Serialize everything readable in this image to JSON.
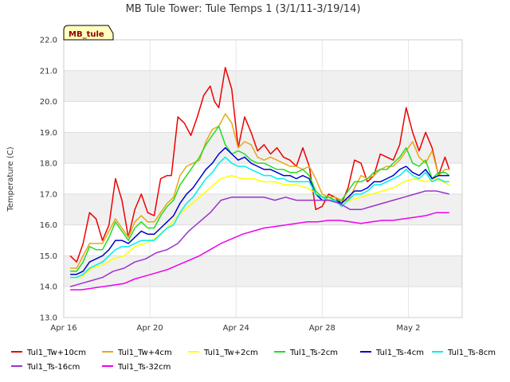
{
  "chart_data": {
    "type": "line",
    "title": "MB Tule Tower: Tule Temps 1 (3/1/11-3/19/14)",
    "badge": "MB_tule",
    "ylabel": "Temperature (C)",
    "xlabel": "",
    "x_ticks": [
      {
        "day": 0,
        "label": "Apr 16"
      },
      {
        "day": 4,
        "label": "Apr 20"
      },
      {
        "day": 8,
        "label": "Apr 24"
      },
      {
        "day": 12,
        "label": "Apr 28"
      },
      {
        "day": 16,
        "label": "May 2"
      }
    ],
    "xlim": [
      0,
      18.5
    ],
    "ylim": [
      13.0,
      22.0
    ],
    "y_ticks": [
      13.0,
      14.0,
      15.0,
      16.0,
      17.0,
      18.0,
      19.0,
      20.0,
      21.0,
      22.0
    ],
    "y_tick_labels": [
      "13.0",
      "14.0",
      "15.0",
      "16.0",
      "17.0",
      "18.0",
      "19.0",
      "20.0",
      "21.0",
      "22.0"
    ],
    "grid": true,
    "band_fill": "#f0f0f0",
    "legend_position": "bottom",
    "series": [
      {
        "name": "Tul1_Tw+10cm",
        "color": "#ee0000",
        "x": [
          0.3,
          0.6,
          0.9,
          1.2,
          1.5,
          1.8,
          2.1,
          2.4,
          2.7,
          3.0,
          3.3,
          3.6,
          3.9,
          4.2,
          4.5,
          4.8,
          5.0,
          5.3,
          5.6,
          5.9,
          6.2,
          6.5,
          6.8,
          7.0,
          7.2,
          7.5,
          7.8,
          8.1,
          8.4,
          8.7,
          9.0,
          9.3,
          9.6,
          9.9,
          10.2,
          10.5,
          10.8,
          11.1,
          11.4,
          11.7,
          12.0,
          12.3,
          12.6,
          12.9,
          13.2,
          13.5,
          13.8,
          14.1,
          14.4,
          14.7,
          15.0,
          15.3,
          15.6,
          15.9,
          16.2,
          16.5,
          16.8,
          17.1,
          17.4,
          17.7,
          17.9
        ],
        "values": [
          15.0,
          14.8,
          15.4,
          16.4,
          16.2,
          15.5,
          16.0,
          17.5,
          16.8,
          15.6,
          16.5,
          17.0,
          16.4,
          16.3,
          17.5,
          17.6,
          17.6,
          19.5,
          19.3,
          18.9,
          19.5,
          20.2,
          20.5,
          20.0,
          19.8,
          21.1,
          20.4,
          18.5,
          19.5,
          19.0,
          18.4,
          18.6,
          18.3,
          18.5,
          18.2,
          18.1,
          17.9,
          18.5,
          17.9,
          16.5,
          16.6,
          17.0,
          16.9,
          16.7,
          17.2,
          18.1,
          18.0,
          17.4,
          17.6,
          18.3,
          18.2,
          18.1,
          18.6,
          19.8,
          19.0,
          18.4,
          19.0,
          18.5,
          17.6,
          18.2,
          17.8
        ]
      },
      {
        "name": "Tul1_Tw+4cm",
        "color": "#e6a817",
        "x": [
          0.3,
          0.6,
          0.9,
          1.2,
          1.5,
          1.8,
          2.1,
          2.4,
          2.7,
          3.0,
          3.3,
          3.6,
          3.9,
          4.2,
          4.5,
          4.8,
          5.1,
          5.4,
          5.7,
          6.0,
          6.3,
          6.6,
          6.9,
          7.2,
          7.5,
          7.8,
          8.1,
          8.4,
          8.7,
          9.0,
          9.3,
          9.6,
          9.9,
          10.2,
          10.5,
          10.8,
          11.1,
          11.4,
          11.7,
          12.0,
          12.3,
          12.6,
          12.9,
          13.2,
          13.5,
          13.8,
          14.1,
          14.4,
          14.7,
          15.0,
          15.3,
          15.6,
          15.9,
          16.2,
          16.5,
          16.8,
          17.1,
          17.4,
          17.7,
          17.9
        ],
        "values": [
          14.6,
          14.6,
          15.0,
          15.4,
          15.4,
          15.4,
          15.8,
          16.2,
          15.9,
          15.6,
          16.1,
          16.3,
          16.1,
          16.1,
          16.4,
          16.7,
          16.9,
          17.6,
          17.9,
          18.0,
          18.1,
          18.7,
          19.1,
          19.2,
          19.6,
          19.3,
          18.5,
          18.7,
          18.6,
          18.2,
          18.1,
          18.2,
          18.1,
          18.0,
          17.9,
          17.9,
          17.8,
          17.9,
          17.5,
          17.0,
          16.9,
          16.9,
          16.8,
          16.8,
          17.2,
          17.6,
          17.5,
          17.6,
          17.8,
          17.9,
          17.9,
          18.1,
          18.4,
          18.7,
          18.2,
          18.0,
          18.4,
          17.6,
          17.8,
          17.8
        ]
      },
      {
        "name": "Tul1_Tw+2cm",
        "color": "#ffff00",
        "x": [
          0.3,
          0.8,
          1.3,
          1.8,
          2.3,
          2.8,
          3.3,
          3.8,
          4.3,
          4.8,
          5.3,
          5.8,
          6.3,
          6.8,
          7.3,
          7.8,
          8.3,
          8.8,
          9.3,
          9.8,
          10.3,
          10.8,
          11.3,
          11.8,
          12.3,
          12.8,
          13.3,
          13.8,
          14.3,
          14.8,
          15.3,
          15.8,
          16.3,
          16.8,
          17.3,
          17.9
        ],
        "values": [
          14.3,
          14.3,
          14.6,
          14.7,
          14.9,
          15.0,
          15.3,
          15.4,
          15.6,
          15.9,
          16.3,
          16.6,
          16.9,
          17.2,
          17.5,
          17.6,
          17.5,
          17.5,
          17.4,
          17.4,
          17.3,
          17.3,
          17.2,
          17.0,
          16.8,
          16.7,
          16.8,
          16.9,
          17.0,
          17.1,
          17.2,
          17.4,
          17.5,
          17.4,
          17.5,
          17.3
        ]
      },
      {
        "name": "Tul1_Ts-2cm",
        "color": "#22dd22",
        "x": [
          0.3,
          0.6,
          0.9,
          1.2,
          1.5,
          1.8,
          2.1,
          2.4,
          2.7,
          3.0,
          3.3,
          3.6,
          3.9,
          4.2,
          4.5,
          4.8,
          5.1,
          5.4,
          5.7,
          6.0,
          6.3,
          6.6,
          6.9,
          7.2,
          7.5,
          7.8,
          8.1,
          8.4,
          8.7,
          9.0,
          9.3,
          9.6,
          9.9,
          10.2,
          10.5,
          10.8,
          11.1,
          11.4,
          11.7,
          12.0,
          12.3,
          12.6,
          12.9,
          13.2,
          13.5,
          13.8,
          14.1,
          14.4,
          14.7,
          15.0,
          15.3,
          15.6,
          15.9,
          16.2,
          16.5,
          16.8,
          17.1,
          17.4,
          17.7,
          17.9
        ],
        "values": [
          14.5,
          14.5,
          14.8,
          15.3,
          15.2,
          15.2,
          15.6,
          16.1,
          15.8,
          15.5,
          15.9,
          16.1,
          15.9,
          15.9,
          16.3,
          16.6,
          16.8,
          17.3,
          17.6,
          17.9,
          18.2,
          18.6,
          18.9,
          19.2,
          18.6,
          18.3,
          18.4,
          18.3,
          18.1,
          18.0,
          18.0,
          17.9,
          17.8,
          17.8,
          17.7,
          17.7,
          17.8,
          17.6,
          17.1,
          16.9,
          16.9,
          16.8,
          16.8,
          17.1,
          17.4,
          17.4,
          17.5,
          17.7,
          17.8,
          17.8,
          18.0,
          18.2,
          18.5,
          18.0,
          17.9,
          18.1,
          17.5,
          17.7,
          17.7,
          17.6
        ]
      },
      {
        "name": "Tul1_Ts-4cm",
        "color": "#0000cc",
        "x": [
          0.3,
          0.6,
          0.9,
          1.2,
          1.5,
          1.8,
          2.1,
          2.4,
          2.7,
          3.0,
          3.3,
          3.6,
          3.9,
          4.2,
          4.5,
          4.8,
          5.1,
          5.4,
          5.7,
          6.0,
          6.3,
          6.6,
          6.9,
          7.2,
          7.5,
          7.8,
          8.1,
          8.4,
          8.7,
          9.0,
          9.3,
          9.6,
          9.9,
          10.2,
          10.5,
          10.8,
          11.1,
          11.4,
          11.7,
          12.0,
          12.3,
          12.6,
          12.9,
          13.2,
          13.5,
          13.8,
          14.1,
          14.4,
          14.7,
          15.0,
          15.3,
          15.6,
          15.9,
          16.2,
          16.5,
          16.8,
          17.1,
          17.4,
          17.7,
          17.9
        ],
        "values": [
          14.4,
          14.4,
          14.5,
          14.8,
          14.9,
          15.0,
          15.2,
          15.5,
          15.5,
          15.4,
          15.6,
          15.8,
          15.7,
          15.7,
          15.9,
          16.1,
          16.3,
          16.7,
          17.0,
          17.2,
          17.5,
          17.8,
          18.0,
          18.3,
          18.5,
          18.3,
          18.1,
          18.2,
          18.0,
          17.9,
          17.8,
          17.8,
          17.7,
          17.6,
          17.6,
          17.5,
          17.6,
          17.5,
          17.0,
          16.8,
          16.8,
          16.8,
          16.7,
          16.9,
          17.1,
          17.1,
          17.2,
          17.4,
          17.4,
          17.5,
          17.6,
          17.8,
          17.9,
          17.7,
          17.6,
          17.8,
          17.5,
          17.6,
          17.6,
          17.6
        ]
      },
      {
        "name": "Tul1_Ts-8cm",
        "color": "#00eeee",
        "x": [
          0.3,
          0.6,
          0.9,
          1.2,
          1.5,
          1.8,
          2.1,
          2.4,
          2.7,
          3.0,
          3.3,
          3.6,
          3.9,
          4.2,
          4.5,
          4.8,
          5.1,
          5.4,
          5.7,
          6.0,
          6.3,
          6.6,
          6.9,
          7.2,
          7.5,
          7.8,
          8.1,
          8.4,
          8.7,
          9.0,
          9.3,
          9.6,
          9.9,
          10.2,
          10.5,
          10.8,
          11.1,
          11.4,
          11.7,
          12.0,
          12.3,
          12.6,
          12.9,
          13.2,
          13.5,
          13.8,
          14.1,
          14.4,
          14.7,
          15.0,
          15.3,
          15.6,
          15.9,
          16.2,
          16.5,
          16.8,
          17.1,
          17.4,
          17.7,
          17.9
        ],
        "values": [
          14.3,
          14.3,
          14.4,
          14.6,
          14.7,
          14.8,
          15.0,
          15.2,
          15.3,
          15.3,
          15.4,
          15.5,
          15.5,
          15.5,
          15.7,
          15.9,
          16.0,
          16.4,
          16.7,
          16.9,
          17.2,
          17.5,
          17.7,
          18.0,
          18.2,
          18.0,
          17.9,
          17.9,
          17.8,
          17.7,
          17.6,
          17.6,
          17.5,
          17.5,
          17.4,
          17.4,
          17.4,
          17.4,
          17.0,
          16.9,
          16.8,
          16.8,
          16.6,
          16.8,
          17.0,
          17.0,
          17.1,
          17.3,
          17.3,
          17.4,
          17.5,
          17.6,
          17.8,
          17.6,
          17.5,
          17.7,
          17.4,
          17.5,
          17.4,
          17.4
        ]
      },
      {
        "name": "Tul1_Ts-16cm",
        "color": "#9933cc",
        "x": [
          0.3,
          0.8,
          1.3,
          1.8,
          2.3,
          2.8,
          3.3,
          3.8,
          4.3,
          4.8,
          5.3,
          5.8,
          6.3,
          6.8,
          7.3,
          7.8,
          8.3,
          8.8,
          9.3,
          9.8,
          10.3,
          10.8,
          11.3,
          11.8,
          12.3,
          12.8,
          13.3,
          13.8,
          14.3,
          14.8,
          15.3,
          15.8,
          16.3,
          16.8,
          17.3,
          17.9
        ],
        "values": [
          14.0,
          14.1,
          14.2,
          14.3,
          14.5,
          14.6,
          14.8,
          14.9,
          15.1,
          15.2,
          15.4,
          15.8,
          16.1,
          16.4,
          16.8,
          16.9,
          16.9,
          16.9,
          16.9,
          16.8,
          16.9,
          16.8,
          16.8,
          16.8,
          16.8,
          16.7,
          16.5,
          16.5,
          16.6,
          16.7,
          16.8,
          16.9,
          17.0,
          17.1,
          17.1,
          17.0
        ]
      },
      {
        "name": "Tul1_Ts-32cm",
        "color": "#ee00ee",
        "x": [
          0.3,
          0.8,
          1.3,
          1.8,
          2.3,
          2.8,
          3.3,
          3.8,
          4.3,
          4.8,
          5.3,
          5.8,
          6.3,
          6.8,
          7.3,
          7.8,
          8.3,
          8.8,
          9.3,
          9.8,
          10.3,
          10.8,
          11.3,
          11.8,
          12.3,
          12.8,
          13.3,
          13.8,
          14.3,
          14.8,
          15.3,
          15.8,
          16.3,
          16.8,
          17.3,
          17.9
        ],
        "values": [
          13.9,
          13.9,
          13.95,
          14.0,
          14.05,
          14.1,
          14.25,
          14.35,
          14.45,
          14.55,
          14.7,
          14.85,
          15.0,
          15.2,
          15.4,
          15.55,
          15.7,
          15.8,
          15.9,
          15.95,
          16.0,
          16.05,
          16.1,
          16.1,
          16.15,
          16.15,
          16.1,
          16.05,
          16.1,
          16.15,
          16.15,
          16.2,
          16.25,
          16.3,
          16.4,
          16.4
        ]
      }
    ]
  }
}
